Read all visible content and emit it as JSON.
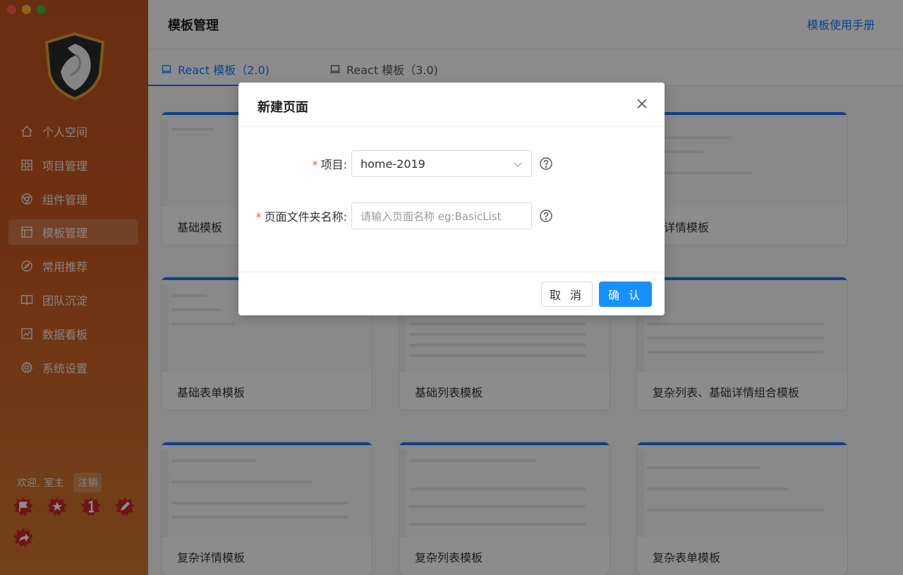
{
  "window": {
    "controls": [
      "close",
      "minimize",
      "maximize"
    ]
  },
  "sidebar": {
    "logo": "hawk-shield-logo",
    "items": [
      {
        "label": "个人空间",
        "icon": "home-icon"
      },
      {
        "label": "项目管理",
        "icon": "grid-icon"
      },
      {
        "label": "组件管理",
        "icon": "chrome-icon"
      },
      {
        "label": "模板管理",
        "icon": "layout-icon",
        "active": true
      },
      {
        "label": "常用推荐",
        "icon": "compass-icon"
      },
      {
        "label": "团队沉淀",
        "icon": "book-icon"
      },
      {
        "label": "数据看板",
        "icon": "line-chart-icon"
      },
      {
        "label": "系统设置",
        "icon": "gear-icon"
      }
    ],
    "welcome": "欢迎,",
    "username": "室主",
    "logout": "注销",
    "badges": [
      "flag-badge",
      "star-badge",
      "number-one-badge",
      "pen-badge",
      "share-badge"
    ]
  },
  "header": {
    "title": "模板管理",
    "manual_link": "模板使用手册"
  },
  "tabs": [
    {
      "label": "React 模板（2.0)",
      "active": true
    },
    {
      "label": "React 模板（3.0)",
      "active": false
    }
  ],
  "cards": [
    "基础模板",
    "",
    "础详情模板",
    "基础表单模板",
    "基础列表模板",
    "复杂列表、基础详情组合模板",
    "复杂详情模板",
    "复杂列表模板",
    "复杂表单模板"
  ],
  "modal": {
    "title": "新建页面",
    "project_label": "项目",
    "project_value": "home-2019",
    "folder_label": "页面文件夹名称",
    "folder_placeholder": "请输入页面名称 eg:BasicList",
    "colon": ":",
    "required_mark": "*",
    "cancel": "取 消",
    "confirm": "确 认"
  },
  "colors": {
    "accent": "#1677ff",
    "sidebar": "#c85a22",
    "danger": "#ff4d4f"
  }
}
